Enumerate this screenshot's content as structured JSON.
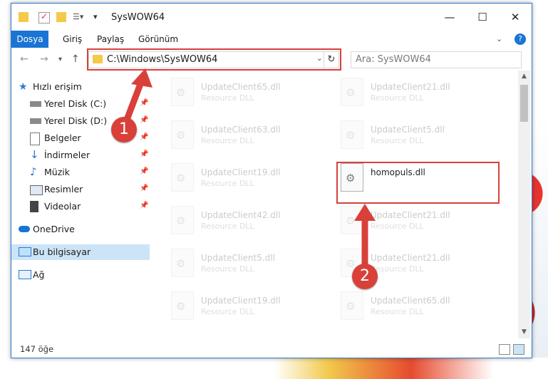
{
  "window": {
    "title": "SysWOW64"
  },
  "ribbon": {
    "tabs": [
      "Dosya",
      "Giriş",
      "Paylaş",
      "Görünüm"
    ]
  },
  "address": {
    "path": "C:\\Windows\\SysWOW64"
  },
  "search": {
    "placeholder": "Ara: SysWOW64"
  },
  "sidebar": {
    "quick_access": "Hızlı erişim",
    "items": [
      "Yerel Disk (C:)",
      "Yerel Disk (D:)",
      "Belgeler",
      "İndirmeler",
      "Müzik",
      "Resimler",
      "Videolar"
    ],
    "onedrive": "OneDrive",
    "this_pc": "Bu bilgisayar",
    "network": "Ağ"
  },
  "files": {
    "col1": [
      {
        "name": "UpdateClient65.dll",
        "type": "Resource DLL"
      },
      {
        "name": "UpdateClient63.dll",
        "type": "Resource DLL"
      },
      {
        "name": "UpdateClient19.dll",
        "type": "Resource DLL"
      },
      {
        "name": "UpdateClient42.dll",
        "type": "Resource DLL"
      },
      {
        "name": "UpdateClient5.dll",
        "type": "Resource DLL"
      },
      {
        "name": "UpdateClient19.dll",
        "type": "Resource DLL"
      }
    ],
    "col2": [
      {
        "name": "UpdateClient21.dll",
        "type": "Resource DLL"
      },
      {
        "name": "UpdateClient5.dll",
        "type": "Resource DLL"
      },
      {
        "name": "homopuls.dll",
        "type": ""
      },
      {
        "name": "UpdateClient21.dll",
        "type": "Resource DLL"
      },
      {
        "name": "UpdateClient21.dll",
        "type": "Resource DLL"
      },
      {
        "name": "UpdateClient65.dll",
        "type": "Resource DLL"
      }
    ]
  },
  "status": {
    "item_count": "147 öğe"
  },
  "annotations": {
    "step1": "1",
    "step2": "2",
    "color": "#d9403a"
  }
}
